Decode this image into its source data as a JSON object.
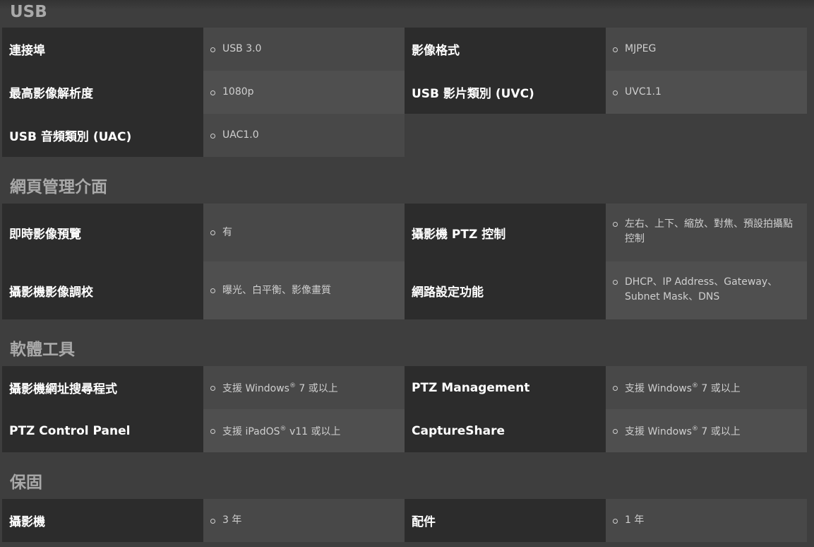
{
  "sections": {
    "usb": {
      "title": "USB",
      "rows": [
        {
          "l1": "連接埠",
          "v1": "USB 3.0",
          "l2": "影像格式",
          "v2": "MJPEG"
        },
        {
          "l1": "最高影像解析度",
          "v1": "1080p",
          "l2": "USB 影片類別 (UVC)",
          "v2": "UVC1.1"
        },
        {
          "l1": "USB 音頻類別 (UAC)",
          "v1": "UAC1.0"
        }
      ]
    },
    "web": {
      "title": "網頁管理介面",
      "rows": [
        {
          "l1": "即時影像預覽",
          "v1": "有",
          "l2": "攝影機 PTZ 控制",
          "v2": "左右、上下、縮放、對焦、預設拍攝點控制"
        },
        {
          "l1": "攝影機影像調校",
          "v1": "曝光、白平衡、影像畫質",
          "l2": "網路設定功能",
          "v2": "DHCP、IP Address、Gateway、Subnet Mask、DNS"
        }
      ]
    },
    "software": {
      "title": "軟體工具",
      "rows": [
        {
          "l1": "攝影機網址搜尋程式",
          "v1_pre": "支援 Windows",
          "v1_sup": "®",
          "v1_post": " 7 或以上",
          "l2": "PTZ Management",
          "v2_pre": "支援 Windows",
          "v2_sup": "®",
          "v2_post": " 7 或以上"
        },
        {
          "l1": "PTZ Control Panel",
          "v1_pre": "支援 iPadOS",
          "v1_sup": "®",
          "v1_post": " v11 或以上",
          "l2": "CaptureShare",
          "v2_pre": "支援 Windows",
          "v2_sup": "®",
          "v2_post": " 7 或以上"
        }
      ]
    },
    "warranty": {
      "title": "保固",
      "rows": [
        {
          "l1": "攝影機",
          "v1": "3 年",
          "l2": "配件",
          "v2": "1 年"
        }
      ]
    }
  }
}
